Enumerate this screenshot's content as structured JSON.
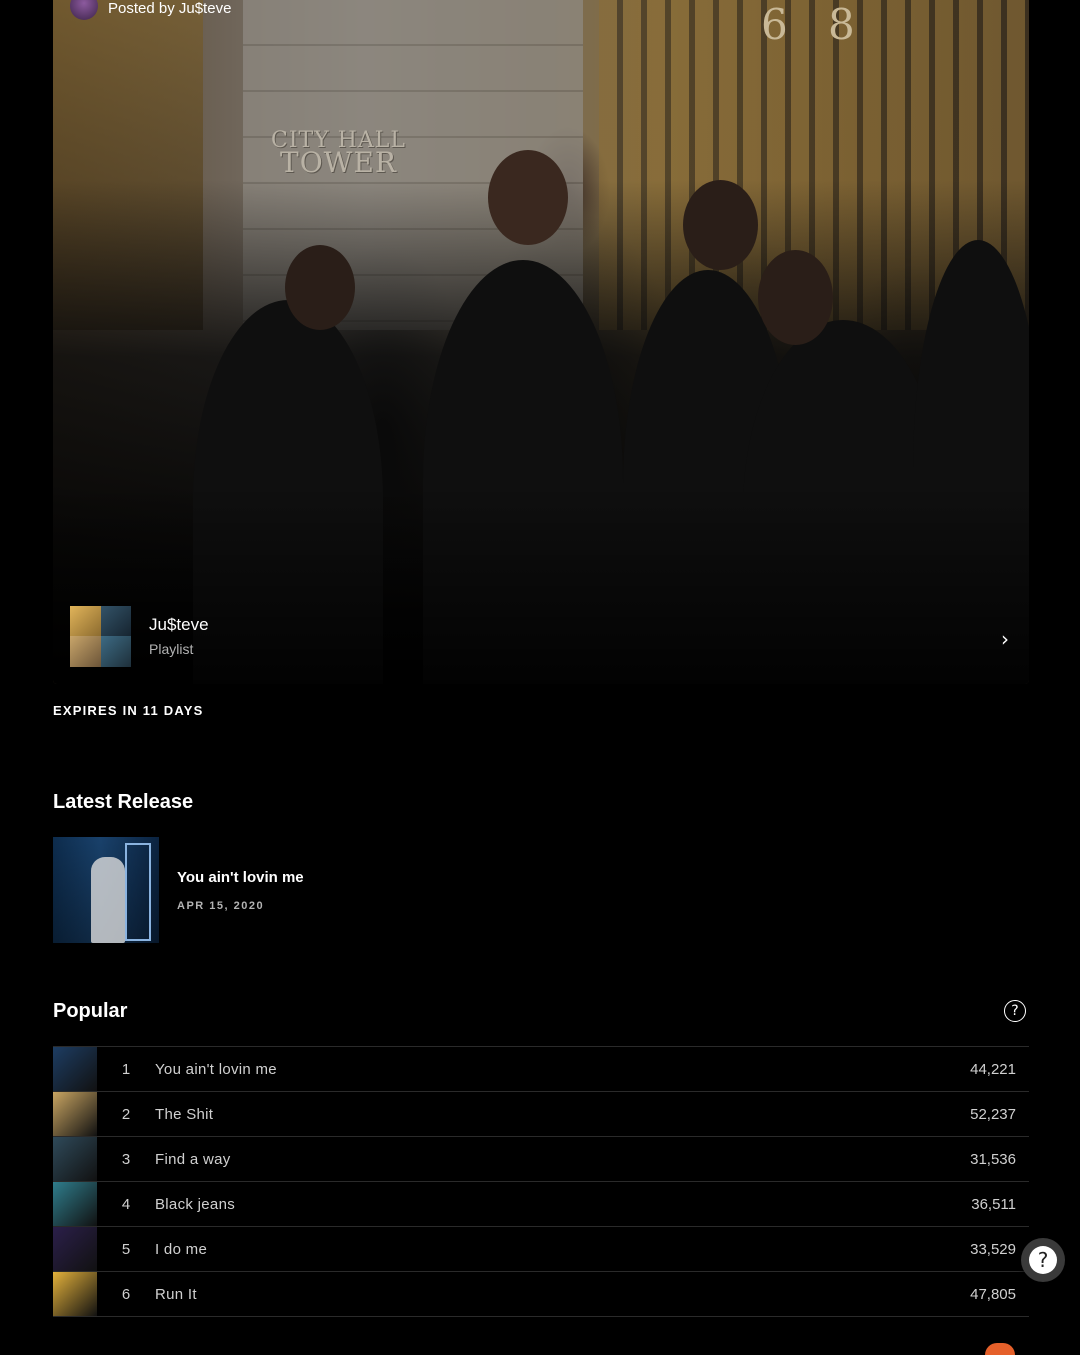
{
  "header": {
    "posted_by": "Posted by Ju$teve"
  },
  "hero": {
    "engraving_line1": "CITY HALL",
    "engraving_line2": "TOWER",
    "door_number_1": "6",
    "door_number_2": "8"
  },
  "playlist": {
    "title": "Ju$teve",
    "subtitle": "Playlist",
    "chevron_icon": "chevron-right-icon"
  },
  "expires": "EXPIRES IN 11 DAYS",
  "latest_release": {
    "heading": "Latest Release",
    "title": "You ain't lovin me",
    "date": "APR 15, 2020"
  },
  "popular": {
    "heading": "Popular",
    "help_icon": "question-circle-icon",
    "tracks": [
      {
        "index": "1",
        "title": "You ain't lovin me",
        "plays": "44,221",
        "thumb_color": "#1d3d63"
      },
      {
        "index": "2",
        "title": "The Shit",
        "plays": "52,237",
        "thumb_color": "#c9a562"
      },
      {
        "index": "3",
        "title": "Find a way",
        "plays": "31,536",
        "thumb_color": "#2f4a5a"
      },
      {
        "index": "4",
        "title": "Black jeans",
        "plays": "36,511",
        "thumb_color": "#2f7d8c"
      },
      {
        "index": "5",
        "title": "I do me",
        "plays": "33,529",
        "thumb_color": "#2b1f4a"
      },
      {
        "index": "6",
        "title": "Run It",
        "plays": "47,805",
        "thumb_color": "#e3b13b"
      }
    ]
  },
  "help_button": {
    "label": "?"
  },
  "colors": {
    "background": "#000000",
    "accent": "#e5602a"
  }
}
